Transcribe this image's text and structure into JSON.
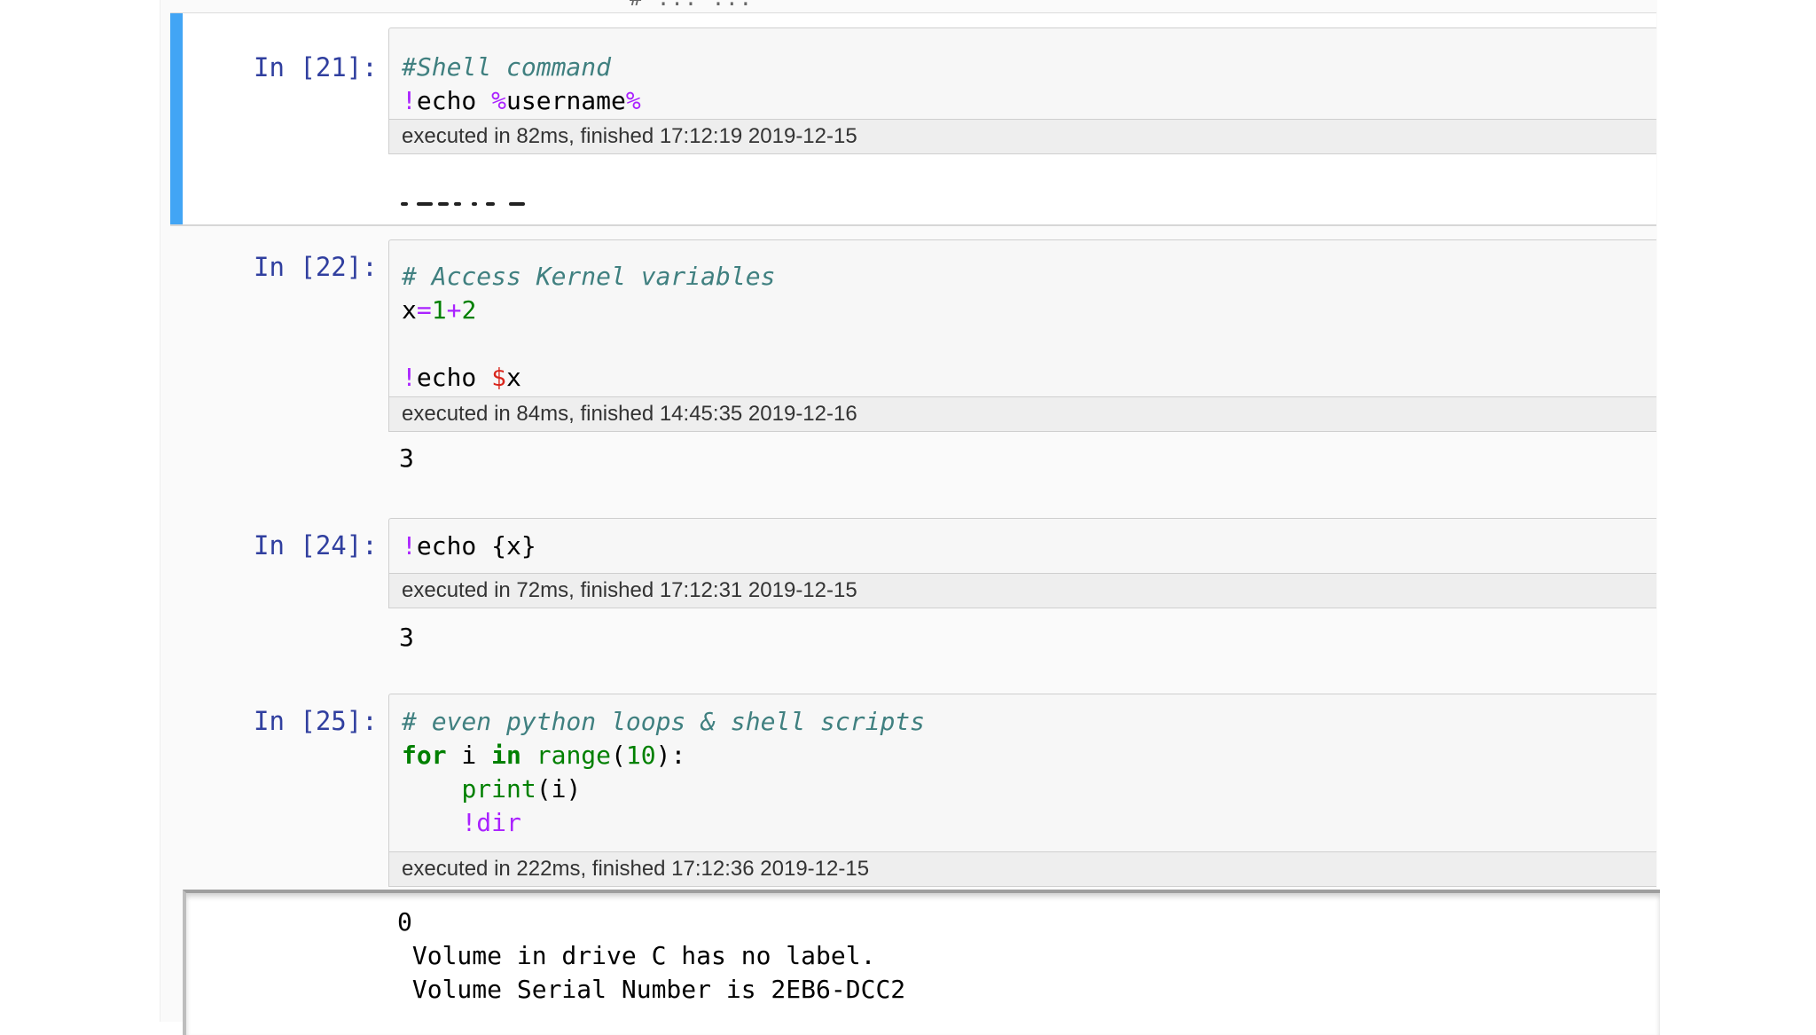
{
  "top_partial_text": "# ... ...",
  "cells": [
    {
      "prompt": "In [21]:",
      "code": [
        [
          {
            "t": "#Shell command",
            "c": "cm"
          }
        ],
        [
          {
            "t": "!",
            "c": "bang"
          },
          {
            "t": "echo ",
            "c": ""
          },
          {
            "t": "%",
            "c": "bang"
          },
          {
            "t": "username",
            "c": ""
          },
          {
            "t": "%",
            "c": "bang"
          }
        ]
      ],
      "timing": "executed in 82ms, finished 17:12:19 2019-12-15",
      "output": ""
    },
    {
      "prompt": "In [22]:",
      "code": [
        [
          {
            "t": "# Access Kernel variables",
            "c": "cm"
          }
        ],
        [
          {
            "t": "x",
            "c": ""
          },
          {
            "t": "=",
            "c": "op"
          },
          {
            "t": "1",
            "c": "num"
          },
          {
            "t": "+",
            "c": "op"
          },
          {
            "t": "2",
            "c": "num"
          }
        ],
        [],
        [
          {
            "t": "!",
            "c": "bang"
          },
          {
            "t": "echo ",
            "c": ""
          },
          {
            "t": "$",
            "c": "red"
          },
          {
            "t": "x",
            "c": ""
          }
        ]
      ],
      "timing": "executed in 84ms, finished 14:45:35 2019-12-16",
      "output": "3"
    },
    {
      "prompt": "In [24]:",
      "code": [
        [
          {
            "t": "!",
            "c": "bang"
          },
          {
            "t": "echo {x}",
            "c": ""
          }
        ]
      ],
      "timing": "executed in 72ms, finished 17:12:31 2019-12-15",
      "output": "3"
    },
    {
      "prompt": "In [25]:",
      "code": [
        [
          {
            "t": "# even python loops & shell scripts",
            "c": "cm"
          }
        ],
        [
          {
            "t": "for",
            "c": "kw"
          },
          {
            "t": " i ",
            "c": ""
          },
          {
            "t": "in",
            "c": "kw"
          },
          {
            "t": " ",
            "c": ""
          },
          {
            "t": "range",
            "c": "bi"
          },
          {
            "t": "(",
            "c": ""
          },
          {
            "t": "10",
            "c": "num"
          },
          {
            "t": "):",
            "c": ""
          }
        ],
        [
          {
            "t": "    ",
            "c": ""
          },
          {
            "t": "print",
            "c": "bi"
          },
          {
            "t": "(i)",
            "c": ""
          }
        ],
        [
          {
            "t": "    ",
            "c": ""
          },
          {
            "t": "!dir",
            "c": "bang"
          }
        ]
      ],
      "timing": "executed in 222ms, finished 17:12:36 2019-12-15",
      "output": "0\n Volume in drive C has no label.\n Volume Serial Number is 2EB6-DCC2"
    }
  ],
  "colors": {
    "selected_bar": "#42a5f5",
    "prompt": "#303f9f",
    "comment": "#408080",
    "magic": "#aa22ff",
    "keyword": "#008000",
    "variable_sigil": "#d9261c"
  }
}
